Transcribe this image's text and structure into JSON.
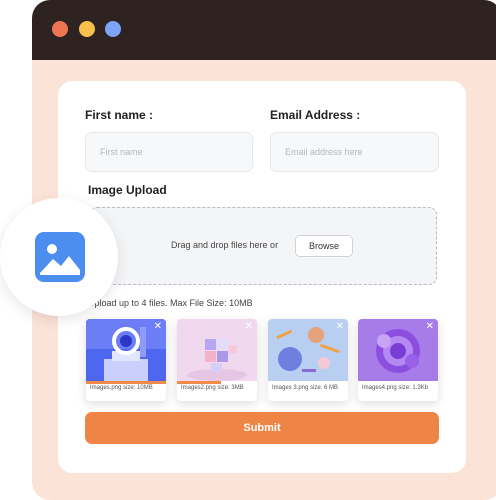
{
  "form": {
    "first_name_label": "First name :",
    "first_name_placeholder": "First name",
    "email_label": "Email Address :",
    "email_placeholder": "Email address here",
    "upload_label": "Image Upload",
    "drop_text": "Drag and drop files here or",
    "browse_label": "Browse",
    "hint": "Upload up to 4 files. Max File Size: 10MB",
    "submit_label": "Submit"
  },
  "files": [
    {
      "caption": "Images.png size: 10MB",
      "progress": 1.0
    },
    {
      "caption": "Images2.png size: 3MB",
      "progress": 0.55
    },
    {
      "caption": "Images 3.png size: 6 MB",
      "progress": 0.0
    },
    {
      "caption": "Images4.png size: 1.3Kb",
      "progress": 0.0
    }
  ],
  "colors": {
    "window_frame": "#fbe3d8",
    "titlebar": "#2e2320",
    "dot_red": "#ef7453",
    "dot_yellow": "#f6c04a",
    "dot_blue": "#7fa4f5",
    "accent": "#ef8447",
    "icon_blue": "#4c8df0"
  },
  "icons": {
    "badge": "image-icon",
    "remove": "close-icon"
  }
}
